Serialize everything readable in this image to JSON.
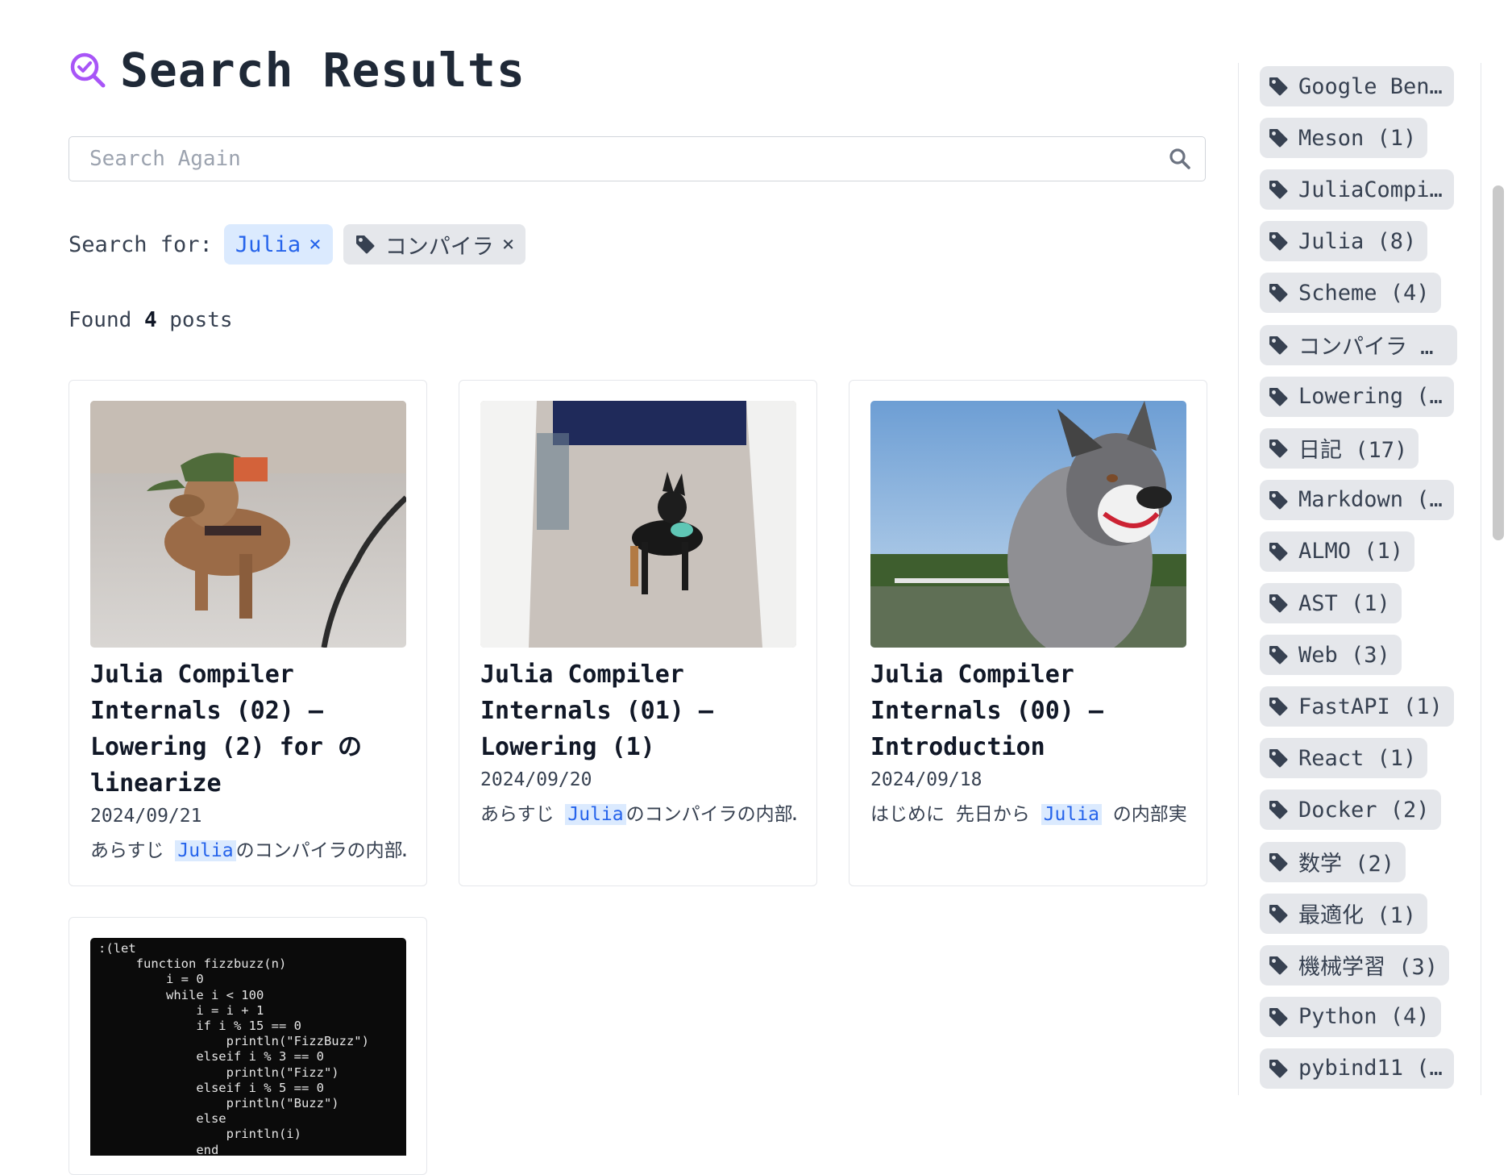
{
  "header": {
    "title": "Search Results"
  },
  "search": {
    "placeholder": "Search Again"
  },
  "filters": {
    "label": "Search for:",
    "keyword": "Julia",
    "tag": "コンパイラ",
    "remove_glyph": "×"
  },
  "results": {
    "prefix": "Found",
    "count": "4",
    "suffix": "posts"
  },
  "posts": [
    {
      "title": "Julia Compiler Internals (02) – Lowering (2) for の linearize",
      "date": "2024/09/21",
      "excerpt_pre": "あらすじ ",
      "excerpt_hl": "Julia",
      "excerpt_post": "のコンパイラの内部…",
      "image": "dachshund-photo"
    },
    {
      "title": "Julia Compiler Internals (01) – Lowering (1)",
      "date": "2024/09/20",
      "excerpt_pre": "あらすじ ",
      "excerpt_hl": "Julia",
      "excerpt_post": "のコンパイラの内部…",
      "image": "pinscher-photo"
    },
    {
      "title": "Julia Compiler Internals (00) – Introduction",
      "date": "2024/09/18",
      "excerpt_pre": "はじめに 先日から ",
      "excerpt_hl": "Julia",
      "excerpt_post": " の内部実…",
      "image": "aussie-shepherd-photo"
    },
    {
      "title": "",
      "date": "",
      "excerpt_pre": "",
      "excerpt_hl": "",
      "excerpt_post": "",
      "image": "terminal-code"
    }
  ],
  "code_lines": [
    ":(let",
    "     function fizzbuzz(n)",
    "         i = 0",
    "         while i < 100",
    "             i = i + 1",
    "             if i % 15 == 0",
    "                 println(\"FizzBuzz\")",
    "             elseif i % 3 == 0",
    "                 println(\"Fizz\")",
    "             elseif i % 5 == 0",
    "                 println(\"Buzz\")",
    "             else",
    "                 println(i)",
    "             end"
  ],
  "sidebar": {
    "tags": [
      "Google Ben…",
      "Meson (1)",
      "JuliaCompi…",
      "Julia (8)",
      "Scheme (4)",
      "コンパイラ (…",
      "Lowering (…",
      "日記 (17)",
      "Markdown (…",
      "ALMO (1)",
      "AST (1)",
      "Web (3)",
      "FastAPI (1)",
      "React (1)",
      "Docker (2)",
      "数学 (2)",
      "最適化 (1)",
      "機械学習 (3)",
      "Python (4)",
      "pybind11 (…"
    ]
  },
  "colors": {
    "accent": "#2563eb",
    "chip_bg": "#dbeafe",
    "tag_bg": "#e5e7eb",
    "icon_purple": "#a855f7"
  }
}
